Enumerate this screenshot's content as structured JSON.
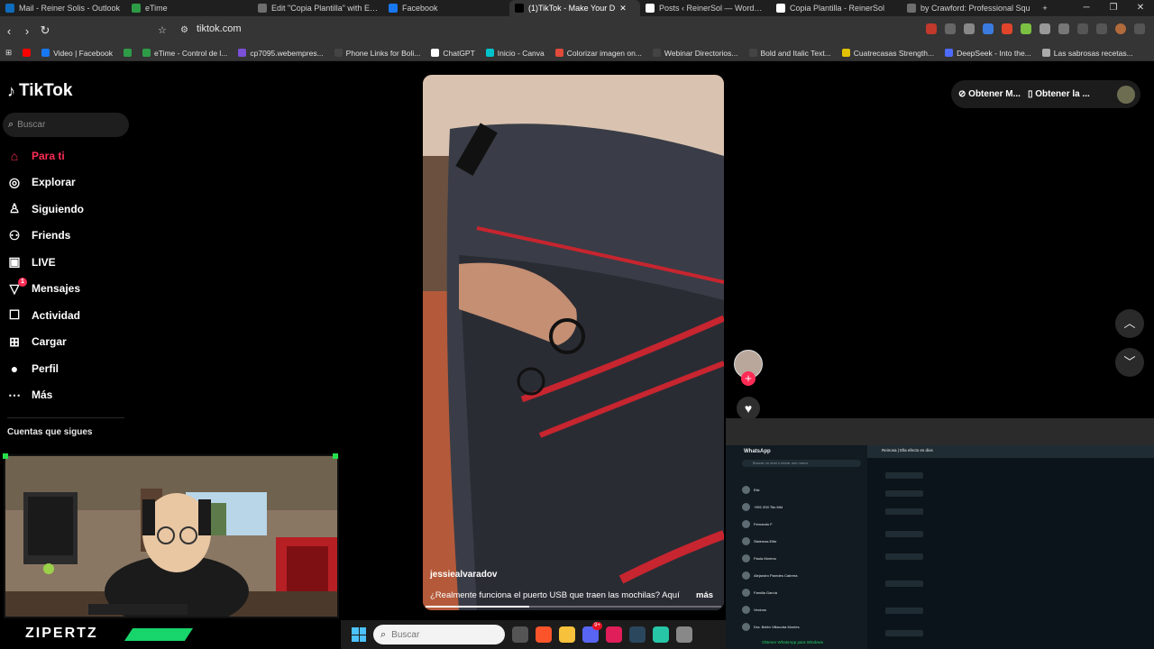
{
  "browser": {
    "tabs": [
      {
        "title": "Mail - Reiner Solis - Outlook",
        "icon": "outlook-icon",
        "color": "#0f6cbd"
      },
      {
        "title": "eTime",
        "icon": "etime-icon",
        "color": "#2e9c47"
      },
      {
        "title": "Edit \"Copia Plantilla\" with Elem",
        "icon": "globe-icon",
        "color": "#6e6e6e"
      },
      {
        "title": "Facebook",
        "icon": "facebook-icon",
        "color": "#1877f2"
      },
      {
        "title": "(1)TikTok - Make Your D",
        "icon": "tiktok-icon",
        "color": "#000000",
        "active": true
      },
      {
        "title": "Posts ‹ ReinerSol — WordPress",
        "icon": "reinersol-icon",
        "color": "#ffffff"
      },
      {
        "title": "Copia Plantilla - ReinerSol",
        "icon": "reinersol-icon",
        "color": "#ffffff"
      },
      {
        "title": "by Crawford: Professional Squ",
        "icon": "globe-icon",
        "color": "#6e6e6e"
      }
    ],
    "url": "tiktok.com",
    "bookmarks": [
      {
        "label": "",
        "color": "#ff0000",
        "icon": "youtube-icon"
      },
      {
        "label": "Video | Facebook",
        "color": "#1877f2",
        "icon": "facebook-icon"
      },
      {
        "label": "",
        "color": "#2e9c47",
        "icon": "badge-3-icon"
      },
      {
        "label": "eTime - Control de l...",
        "color": "#2e9c47",
        "icon": "etime-icon"
      },
      {
        "label": "cp7095.webempres...",
        "color": "#7b4fd6",
        "icon": "cpanel-icon"
      },
      {
        "label": "Phone Links for Boli...",
        "color": "#444444",
        "icon": "page-icon"
      },
      {
        "label": "ChatGPT",
        "color": "#ffffff",
        "icon": "chatgpt-icon"
      },
      {
        "label": "Inicio - Canva",
        "color": "#00c4cc",
        "icon": "canva-icon"
      },
      {
        "label": "Colorizar imagen on...",
        "color": "#e04a3a",
        "icon": "colorize-icon"
      },
      {
        "label": "Webinar Directorios...",
        "color": "#444444",
        "icon": "page-icon"
      },
      {
        "label": "Bold and Italic Text...",
        "color": "#444444",
        "icon": "page-icon"
      },
      {
        "label": "Cuatrecasas Strength...",
        "color": "#e2c200",
        "icon": "cuatrecasas-icon"
      },
      {
        "label": "DeepSeek - Into the...",
        "color": "#4d6bfe",
        "icon": "deepseek-icon"
      },
      {
        "label": "Las sabrosas recetas...",
        "color": "#aaaaaa",
        "icon": "globe-icon"
      }
    ]
  },
  "tiktok": {
    "logo": "TikTok",
    "search_placeholder": "Buscar",
    "nav": [
      {
        "label": "Para ti",
        "icon": "home-icon",
        "glyph": "⌂",
        "active": true
      },
      {
        "label": "Explorar",
        "icon": "compass-icon",
        "glyph": "◎"
      },
      {
        "label": "Siguiendo",
        "icon": "following-icon",
        "glyph": "♙"
      },
      {
        "label": "Friends",
        "icon": "friends-icon",
        "glyph": "⚇"
      },
      {
        "label": "LIVE",
        "icon": "live-icon",
        "glyph": "▣"
      },
      {
        "label": "Mensajes",
        "icon": "messages-icon",
        "glyph": "▽",
        "badge": "1"
      },
      {
        "label": "Actividad",
        "icon": "activity-icon",
        "glyph": "☐"
      },
      {
        "label": "Cargar",
        "icon": "upload-icon",
        "glyph": "⊞"
      },
      {
        "label": "Perfil",
        "icon": "profile-icon",
        "glyph": "●"
      },
      {
        "label": "Más",
        "icon": "more-icon",
        "glyph": "⋯"
      }
    ],
    "following_title": "Cuentas que sigues",
    "top_right": {
      "get_app": "Obtener M...",
      "get_desktop": "Obtener la ..."
    },
    "video": {
      "author": "jessiealvaradov",
      "caption": "¿Realmente funciona el puerto USB que traen las mochilas? Aquí",
      "more": "más",
      "progress": 0.35
    }
  },
  "streamer": {
    "name": "ZIPERTZ",
    "accent_color": "#17d46b"
  },
  "whatsapp": {
    "title": "WhatsApp",
    "search_placeholder": "Buscar un chat o iniciar uno nuevo",
    "chats": [
      "Elsi",
      "+591 000 Tito Mid",
      "Fernando F",
      "Sistemas Elite",
      "Paula Moreno",
      "Alejandro Paredes Cabrera",
      "Familia García",
      "Vecinos",
      "Dra. Belén Villacorta Montes"
    ],
    "chat_header": "Reinosa | Ella efecto es dios",
    "footer": "Obtener WhatsApp para Windows"
  },
  "taskbar": {
    "search_placeholder": "Buscar",
    "discord_badge": "9+"
  }
}
